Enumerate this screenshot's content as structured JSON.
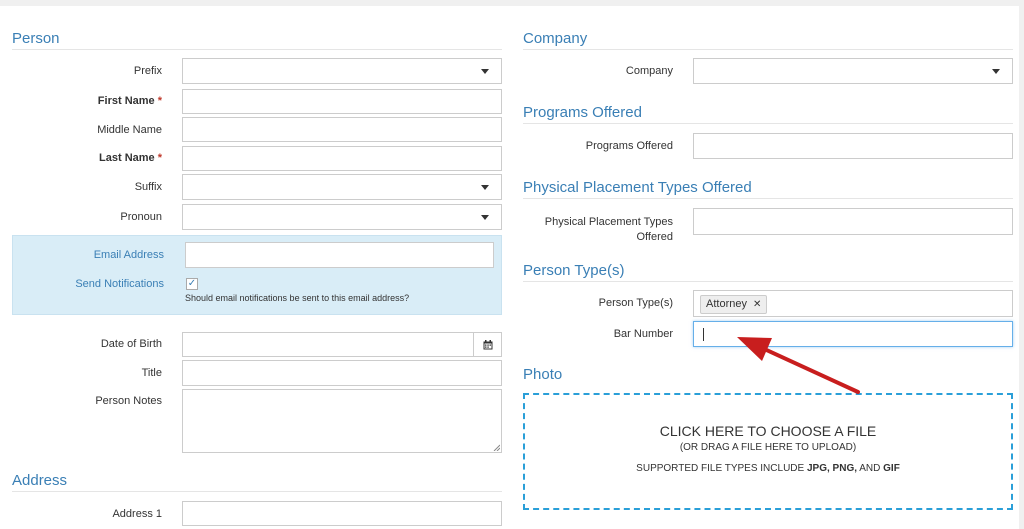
{
  "person": {
    "title": "Person",
    "prefix_label": "Prefix",
    "first_name_label": "First Name",
    "middle_name_label": "Middle Name",
    "last_name_label": "Last Name",
    "suffix_label": "Suffix",
    "pronoun_label": "Pronoun",
    "required_marker": "*",
    "email_label": "Email Address",
    "send_notifications_label": "Send Notifications",
    "send_notifications_checkmark": "✓",
    "notifications_hint": "Should email notifications be sent to this email address?",
    "dob_label": "Date of Birth",
    "title_label": "Title",
    "notes_label": "Person Notes"
  },
  "address": {
    "title": "Address",
    "address1_label": "Address 1"
  },
  "company": {
    "title": "Company",
    "company_label": "Company"
  },
  "programs": {
    "title": "Programs Offered",
    "label": "Programs Offered"
  },
  "placement": {
    "title": "Physical Placement Types Offered",
    "label_line1": "Physical Placement Types",
    "label_line2": "Offered"
  },
  "person_types": {
    "title": "Person Type(s)",
    "label": "Person Type(s)",
    "tag": "Attorney",
    "tag_remove": "✕",
    "bar_number_label": "Bar Number",
    "bar_number_value": ""
  },
  "photo": {
    "title": "Photo",
    "main": "CLICK HERE TO CHOOSE A FILE",
    "sub": "(OR DRAG A FILE HERE TO UPLOAD)",
    "types_prefix": "SUPPORTED FILE TYPES INCLUDE",
    "type_jpg": "JPG,",
    "type_png": "PNG,",
    "types_and": "AND",
    "type_gif": "GIF"
  },
  "colors": {
    "accent": "#3a7fb5",
    "info_bg": "#d9edf7",
    "required": "#c0392b",
    "arrow": "#c81e1e",
    "dropzone_border": "#2a9fd8"
  },
  "icons": {
    "calendar": "calendar-icon",
    "caret": "caret-down-icon",
    "arrow": "red-arrow-annotation"
  }
}
